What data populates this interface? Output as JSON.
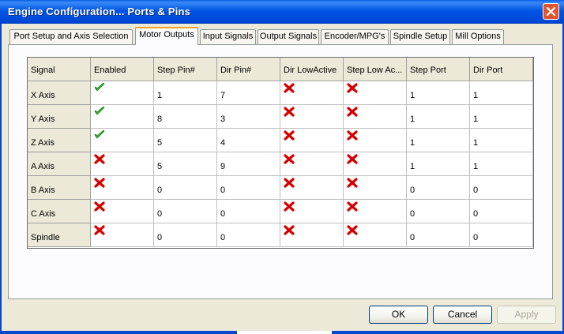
{
  "window": {
    "title": "Engine Configuration... Ports & Pins",
    "close_icon": "close-icon"
  },
  "tabs": [
    {
      "label": "Port Setup and Axis Selection",
      "active": false
    },
    {
      "label": "Motor Outputs",
      "active": true
    },
    {
      "label": "Input Signals",
      "active": false
    },
    {
      "label": "Output Signals",
      "active": false
    },
    {
      "label": "Encoder/MPG's",
      "active": false
    },
    {
      "label": "Spindle Setup",
      "active": false
    },
    {
      "label": "Mill Options",
      "active": false
    }
  ],
  "table": {
    "columns": [
      "Signal",
      "Enabled",
      "Step Pin#",
      "Dir Pin#",
      "Dir LowActive",
      "Step Low Ac...",
      "Step Port",
      "Dir Port"
    ],
    "rows": [
      {
        "signal": "X Axis",
        "enabled": true,
        "step_pin": "1",
        "dir_pin": "7",
        "dir_low_active": false,
        "step_low_active": false,
        "step_port": "1",
        "dir_port": "1"
      },
      {
        "signal": "Y Axis",
        "enabled": true,
        "step_pin": "8",
        "dir_pin": "3",
        "dir_low_active": false,
        "step_low_active": false,
        "step_port": "1",
        "dir_port": "1"
      },
      {
        "signal": "Z Axis",
        "enabled": true,
        "step_pin": "5",
        "dir_pin": "4",
        "dir_low_active": false,
        "step_low_active": false,
        "step_port": "1",
        "dir_port": "1"
      },
      {
        "signal": "A Axis",
        "enabled": false,
        "step_pin": "5",
        "dir_pin": "9",
        "dir_low_active": false,
        "step_low_active": false,
        "step_port": "1",
        "dir_port": "1"
      },
      {
        "signal": "B Axis",
        "enabled": false,
        "step_pin": "0",
        "dir_pin": "0",
        "dir_low_active": false,
        "step_low_active": false,
        "step_port": "0",
        "dir_port": "0"
      },
      {
        "signal": "C Axis",
        "enabled": false,
        "step_pin": "0",
        "dir_pin": "0",
        "dir_low_active": false,
        "step_low_active": false,
        "step_port": "0",
        "dir_port": "0"
      },
      {
        "signal": "Spindle",
        "enabled": false,
        "step_pin": "0",
        "dir_pin": "0",
        "dir_low_active": false,
        "step_low_active": false,
        "step_port": "0",
        "dir_port": "0"
      }
    ]
  },
  "icons": {
    "enabled_true": "green-check-icon",
    "enabled_false": "red-x-icon"
  },
  "colors": {
    "check": "#2fc22f",
    "cross": "#e00000",
    "active_tab_accent": "#f5a41f"
  },
  "buttons": {
    "ok": "OK",
    "cancel": "Cancel",
    "apply": "Apply"
  }
}
